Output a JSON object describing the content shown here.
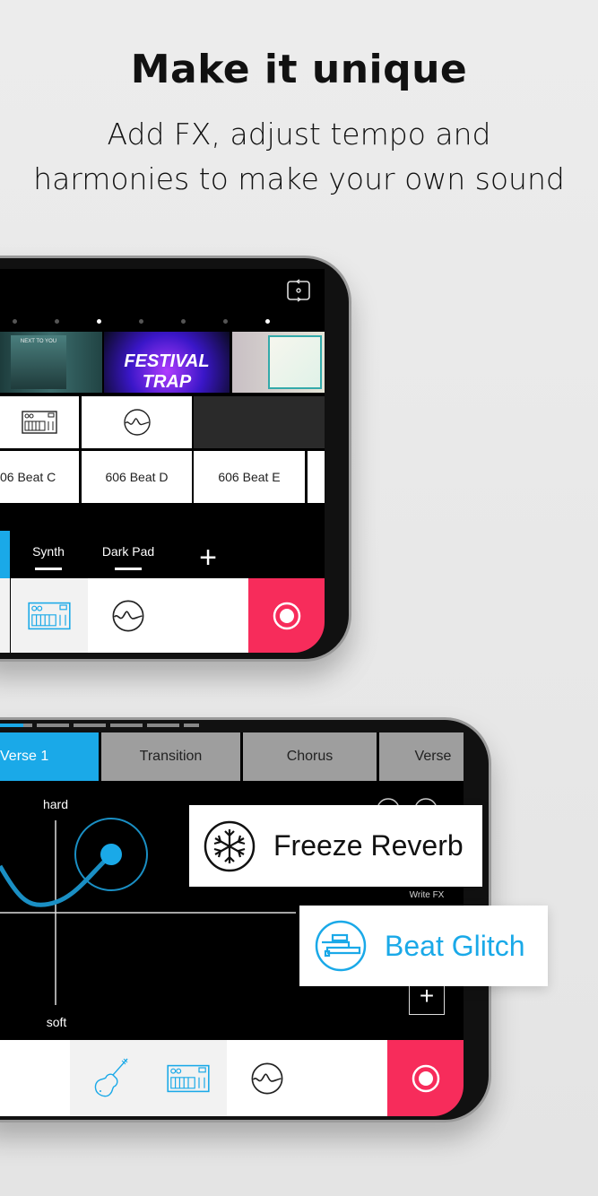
{
  "header": {
    "title": "Make it unique",
    "subtitle_line1": "Add FX, adjust tempo and",
    "subtitle_line2": "harmonies to make your own sound"
  },
  "phone1": {
    "top_icon": "switch-camera-icon",
    "pager_dots": 7,
    "albums": [
      {
        "name": "next-to-you-cover",
        "text": "NEXT TO YOU"
      },
      {
        "name": "festival-trap-cover",
        "text": "FESTIVAL TRAP"
      },
      {
        "name": "pastel-tropical-cover"
      }
    ],
    "beats": [
      "06 Beat C",
      "606 Beat D",
      "606 Beat E"
    ],
    "tabs": [
      {
        "label": "Synth"
      },
      {
        "label": "Dark Pad"
      }
    ],
    "add_label": "+"
  },
  "phone2": {
    "sections": [
      "Verse 1",
      "Transition",
      "Chorus",
      "Verse"
    ],
    "pad": {
      "top_label": "hard",
      "bottom_label": "soft"
    },
    "write_fx": "Write FX",
    "add_label": "+"
  },
  "callouts": {
    "freeze": "Freeze Reverb",
    "glitch": "Beat Glitch"
  },
  "colors": {
    "accent": "#1aa9e8",
    "record": "#f72c5b",
    "background": "#e8e8e8"
  }
}
